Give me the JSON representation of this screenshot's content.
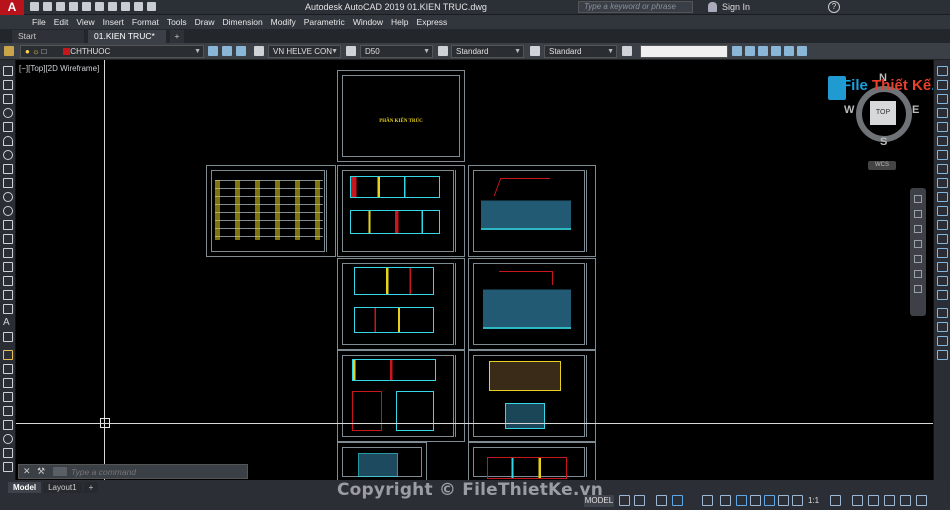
{
  "app": {
    "logo_letter": "A",
    "title": "Autodesk AutoCAD 2019    01.KIEN TRUC.dwg",
    "search_placeholder": "Type a keyword or phrase",
    "sign_in": "Sign In",
    "help": "?"
  },
  "menu": [
    "File",
    "Edit",
    "View",
    "Insert",
    "Format",
    "Tools",
    "Draw",
    "Dimension",
    "Modify",
    "Parametric",
    "Window",
    "Help",
    "Express"
  ],
  "tabs": {
    "start": "Start",
    "file": "01.KIEN TRUC*",
    "new": "+"
  },
  "toolbar": {
    "layer": "KICHTHUOC",
    "text_style": "VN HELVE CON",
    "dim_style": "D50",
    "table_style": "Standard",
    "multileader_style": "Standard",
    "blank": ""
  },
  "viewport": {
    "label": "[−][Top][2D Wireframe]",
    "cover_title": "PHẦN KIẾN TRÚC"
  },
  "viewcube": {
    "n": "N",
    "s": "S",
    "e": "E",
    "w": "W",
    "face": "TOP",
    "wcs": "WCS"
  },
  "command": {
    "close": "✕",
    "settings": "⚒",
    "placeholder": "Type a command"
  },
  "layouts": [
    "Model",
    "Layout1",
    "+"
  ],
  "status": {
    "model": "MODEL",
    "scale": "1:1"
  },
  "watermark": {
    "brand_a": "File ",
    "brand_b": "Thiết Kế",
    ".vn": ".vn",
    "copyright": "Copyright © FileThietKe.vn"
  },
  "colors": {
    "brand_red": "#b8121b",
    "accent_blue": "#1aa0dc",
    "drawing_yellow": "#e6d21c",
    "drawing_cyan": "#35d7e6"
  }
}
